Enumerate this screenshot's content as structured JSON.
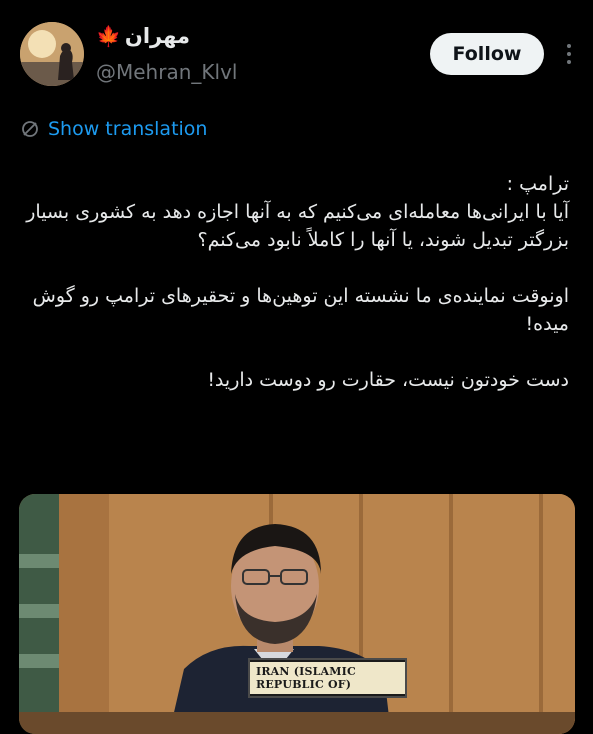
{
  "author": {
    "display_name": "مهران",
    "handle": "@Mehran_Klvl",
    "verified_badge": "maple-leaf"
  },
  "follow_button": {
    "label": "Follow"
  },
  "translation": {
    "label": "Show translation"
  },
  "tweet": {
    "paragraphs": [
      "ترامپ :",
      "آیا با ایرانی‌ها معامله‌ای می‌کنیم که به آنها اجازه دهد به کشوری بسیار بزرگتر تبدیل شوند، یا آنها را کاملاً نابود می‌کنم؟",
      "اونوقت نماینده‌ی ما نشسته این توهین‌ها و تحقیرهای ترامپ رو گوش میده!",
      "دست خودتون نیست، حقارت رو دوست دارید!"
    ]
  },
  "media": {
    "nameplate": "IRAN (ISLAMIC REPUBLIC OF)"
  },
  "colors": {
    "background": "#000000",
    "text": "#e7e9ea",
    "secondary": "#71767b",
    "link": "#1d9bf0",
    "follow_bg": "#eff3f4"
  }
}
